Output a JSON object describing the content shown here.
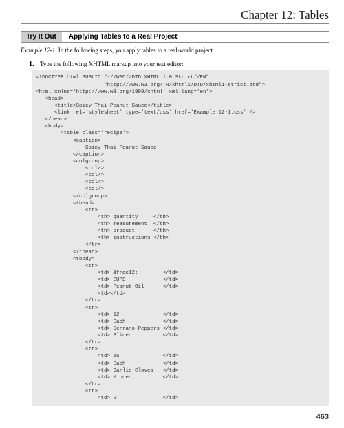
{
  "chapter": "Chapter 12: Tables",
  "tryit_badge": "Try It Out",
  "tryit_title": "Applying Tables to a Real Project",
  "example_label": "Example 12-1.",
  "example_text": " In the following steps, you apply tables to a real-world project.",
  "step_num": "1.",
  "step_text": "Type the following XHTML markup into your text editor:",
  "code": "<!DOCTYPE html PUBLIC \"-//W3C//DTD XHTML 1.0 Strict//EN\"\n                      \"http://www.w3.org/TR/xhtml1/DTD/xhtml1-strict.dtd\">\n<html xmlns='http://www.w3.org/1999/xhtml' xml:lang='en'>\n   <head>\n      <title>Spicy Thai Peanut Sauce</title>\n      <link rel='stylesheet' type='text/css' href='Example_12-1.css' />\n   </head>\n   <body>\n        <table class='recipe'>\n            <caption>\n                Spicy Thai Peanut Sauce\n            </caption>\n            <colgroup>\n                <col/>\n                <col/>\n                <col/>\n                <col/>\n            </colgroup>\n            <thead>\n                <tr>\n                    <th> quantity     </th>\n                    <th> measurement  </th>\n                    <th> product      </th>\n                    <th> instructions </th>\n                </tr>\n            </thead>\n            <tbody>\n                <tr>\n                    <td> &frac12;        </td>\n                    <td> CUPS            </td>\n                    <td> Peanut Oil      </td>\n                    <td></td>\n                </tr>\n                <tr>\n                    <td> 12              </td>\n                    <td> Each            </td>\n                    <td> Serrano Peppers </td>\n                    <td> Sliced          </td>\n                </tr>\n                <tr>\n                    <td> 16              </td>\n                    <td> Each            </td>\n                    <td> Garlic Cloves   </td>\n                    <td> Minced          </td>\n                </tr>\n                <tr>\n                    <td> 2               </td>",
  "page_number": "463"
}
